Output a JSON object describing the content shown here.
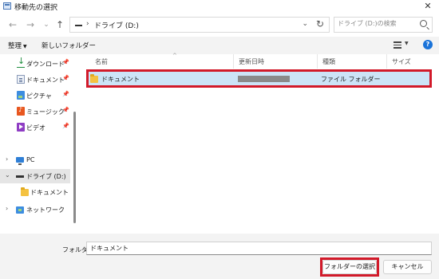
{
  "window": {
    "title": "移動先の選択"
  },
  "address": {
    "path": "ドライブ (D:)",
    "separator": "›"
  },
  "search": {
    "placeholder": "ドライブ (D:)の検索"
  },
  "toolbar": {
    "organize_label": "整理",
    "new_folder_label": "新しいフォルダー"
  },
  "sidebar": {
    "quick_access": [
      {
        "label": "ダウンロード",
        "icon": "download-icon"
      },
      {
        "label": "ドキュメント",
        "icon": "documents-icon"
      },
      {
        "label": "ピクチャ",
        "icon": "pictures-icon"
      },
      {
        "label": "ミュージック",
        "icon": "music-icon"
      },
      {
        "label": "ビデオ",
        "icon": "videos-icon"
      }
    ],
    "tree": [
      {
        "label": "PC",
        "icon": "pc-icon",
        "expanded": false
      },
      {
        "label": "ドライブ (D:)",
        "icon": "drive-icon",
        "expanded": true,
        "selected": true
      },
      {
        "label": "ドキュメント",
        "icon": "folder-icon",
        "child": true
      },
      {
        "label": "ネットワーク",
        "icon": "network-icon",
        "expanded": false
      }
    ]
  },
  "columns": {
    "name": "名前",
    "date": "更新日時",
    "type": "種類",
    "size": "サイズ"
  },
  "files": [
    {
      "name": "ドキュメント",
      "date": "",
      "type": "ファイル フォルダー",
      "selected": true,
      "icon": "folder-icon"
    }
  ],
  "footer": {
    "folder_label": "フォルダー:",
    "folder_value": "ドキュメント"
  },
  "buttons": {
    "select_folder": "フォルダーの選択",
    "cancel": "キャンセル"
  },
  "colors": {
    "highlight": "#d21a2a",
    "selection": "#cce4f7",
    "accent": "#1a73d9"
  }
}
